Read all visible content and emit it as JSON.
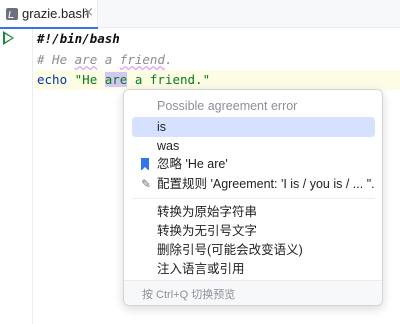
{
  "tab": {
    "label": "grazie.bash",
    "close_glyph": "×",
    "icon": "bash-file-icon"
  },
  "editor": {
    "line1": "#!/bin/bash",
    "line2": {
      "prefix": "# He ",
      "are": "are",
      "mid": " a ",
      "friend": "friend",
      "suffix": "."
    },
    "line3": {
      "keyword": "echo ",
      "str_pre": "\"He ",
      "str_hl": "are",
      "str_post": " a friend.\""
    }
  },
  "popup": {
    "header": "Possible agreement error",
    "items": [
      {
        "label": "is",
        "selected": true
      },
      {
        "label": "was"
      },
      {
        "label": "忽略 'He are'",
        "icon": "bookmark-icon"
      },
      {
        "label": "配置规则 'Agreement: 'I is / you is / ... \"...",
        "icon": "pencil-icon"
      }
    ],
    "intentions": [
      "转换为原始字符串",
      "转换为无引号文字",
      "删除引号(可能会改变语义)",
      "注入语言或引用"
    ],
    "footer": "按 Ctrl+Q 切换预览"
  }
}
